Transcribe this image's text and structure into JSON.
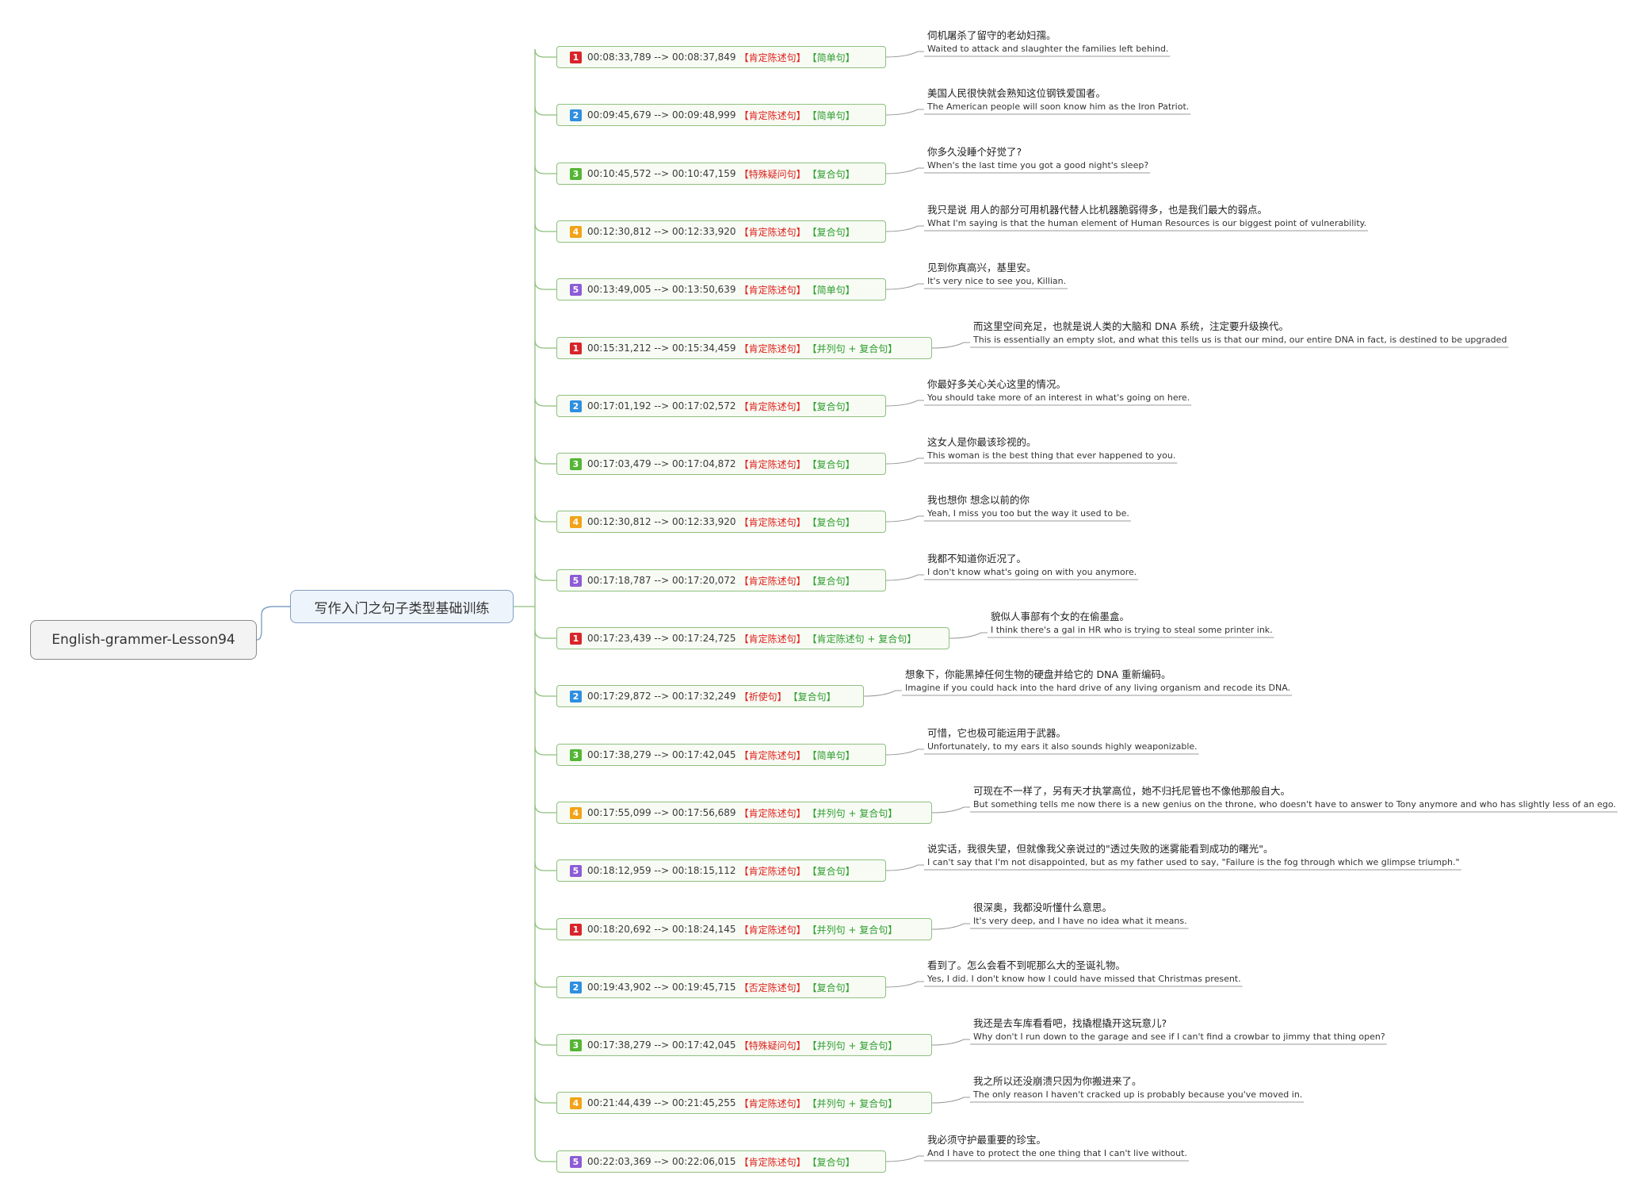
{
  "root": {
    "label": "English-grammer-Lesson94"
  },
  "main": {
    "label": "写作入门之句子类型基础训练"
  },
  "colors": {
    "1": "#d9242b",
    "2": "#2f8fe0",
    "3": "#55b535",
    "4": "#f2a318",
    "5": "#8d5cd6",
    "type_text": "#e0201b",
    "struct_text": "#2f9e2f",
    "connector": "#8cc07a"
  },
  "items": [
    {
      "num": "1",
      "time": "00:08:33,789 --> 00:08:37,849",
      "type": "【肯定陈述句】",
      "struct": "【简单句】",
      "zh": "伺机屠杀了留守的老幼妇孺。",
      "en": "Waited to attack and slaughter the families left behind."
    },
    {
      "num": "2",
      "time": "00:09:45,679 --> 00:09:48,999",
      "type": "【肯定陈述句】",
      "struct": "【简单句】",
      "zh": "美国人民很快就会熟知这位钢铁爱国者。",
      "en": "The American people will soon know him as the Iron Patriot."
    },
    {
      "num": "3",
      "time": "00:10:45,572 --> 00:10:47,159",
      "type": "【特殊疑问句】",
      "struct": "【复合句】",
      "zh": "你多久没睡个好觉了?",
      "en": "When's the last time you got a good night's sleep?"
    },
    {
      "num": "4",
      "time": "00:12:30,812 --> 00:12:33,920",
      "type": "【肯定陈述句】",
      "struct": "【复合句】",
      "zh": "我只是说 用人的部分可用机器代替人比机器脆弱得多，也是我们最大的弱点。",
      "en": "What I'm saying is that the human element of Human Resources is our biggest point of vulnerability."
    },
    {
      "num": "5",
      "time": "00:13:49,005 --> 00:13:50,639",
      "type": "【肯定陈述句】",
      "struct": "【简单句】",
      "zh": "见到你真高兴，基里安。",
      "en": "It's very nice to see you, Killian."
    },
    {
      "num": "1",
      "time": "00:15:31,212 --> 00:15:34,459",
      "type": "【肯定陈述句】",
      "struct": "【并列句 + 复合句】",
      "zh": "而这里空间充足，也就是说人类的大脑和 DNA 系统，注定要升级换代。",
      "en": "This is essentially an empty slot, and what this tells us is that our mind, our entire DNA in fact, is destined to be upgraded"
    },
    {
      "num": "2",
      "time": "00:17:01,192 --> 00:17:02,572",
      "type": "【肯定陈述句】",
      "struct": "【复合句】",
      "zh": "你最好多关心关心这里的情况。",
      "en": "You should take more of an interest in what's going on here."
    },
    {
      "num": "3",
      "time": "00:17:03,479 --> 00:17:04,872",
      "type": "【肯定陈述句】",
      "struct": "【复合句】",
      "zh": "这女人是你最该珍视的。",
      "en": "This woman is the best thing that ever happened to you."
    },
    {
      "num": "4",
      "time": "00:12:30,812 --> 00:12:33,920",
      "type": "【肯定陈述句】",
      "struct": "【复合句】",
      "zh": "我也想你 想念以前的你",
      "en": "Yeah, I miss you too but the way it used to be."
    },
    {
      "num": "5",
      "time": "00:17:18,787 --> 00:17:20,072",
      "type": "【肯定陈述句】",
      "struct": "【复合句】",
      "zh": "我都不知道你近况了。",
      "en": "I don't know what's going on with you anymore."
    },
    {
      "num": "1",
      "time": "00:17:23,439 --> 00:17:24,725",
      "type": "【肯定陈述句】",
      "struct": "【肯定陈述句 + 复合句】",
      "zh": "貌似人事部有个女的在偷墨盒。",
      "en": "I think there's a gal in HR who is trying to steal some printer ink."
    },
    {
      "num": "2",
      "time": "00:17:29,872 --> 00:17:32,249",
      "type": "【祈使句】",
      "struct": "【复合句】",
      "zh": "想象下，你能黑掉任何生物的硬盘并给它的 DNA 重新编码。",
      "en": "Imagine if you could hack into the hard drive of any living organism and recode its DNA."
    },
    {
      "num": "3",
      "time": "00:17:38,279 --> 00:17:42,045",
      "type": "【肯定陈述句】",
      "struct": "【简单句】",
      "zh": "可惜，它也极可能运用于武器。",
      "en": "Unfortunately, to my ears it also sounds highly weaponizable."
    },
    {
      "num": "4",
      "time": "00:17:55,099 --> 00:17:56,689",
      "type": "【肯定陈述句】",
      "struct": "【并列句 + 复合句】",
      "zh": "可现在不一样了，另有天才执掌高位，她不归托尼管也不像他那般自大。",
      "en": "But something tells me now there is a new genius on the throne, who doesn't have to answer to Tony anymore and who has slightly less of an ego."
    },
    {
      "num": "5",
      "time": "00:18:12,959 --> 00:18:15,112",
      "type": "【肯定陈述句】",
      "struct": "【复合句】",
      "zh": "说实话，我很失望，但就像我父亲说过的\"透过失败的迷雾能看到成功的曙光\"。",
      "en": "I can't say that I'm not disappointed, but as my father used to say, \"Failure is the fog through which we glimpse triumph.\""
    },
    {
      "num": "1",
      "time": "00:18:20,692 --> 00:18:24,145",
      "type": "【肯定陈述句】",
      "struct": "【并列句 + 复合句】",
      "zh": "很深奥，我都没听懂什么意思。",
      "en": "It's very deep, and I have no idea what it means."
    },
    {
      "num": "2",
      "time": "00:19:43,902 --> 00:19:45,715",
      "type": "【否定陈述句】",
      "struct": "【复合句】",
      "zh": "看到了。怎么会看不到呢那么大的圣诞礼物。",
      "en": "Yes, I did. I don't know how I could have missed that Christmas present."
    },
    {
      "num": "3",
      "time": "00:17:38,279 --> 00:17:42,045",
      "type": "【特殊疑问句】",
      "struct": "【并列句 + 复合句】",
      "zh": "我还是去车库看看吧，找撬棍撬开这玩意儿?",
      "en": "Why don't I run down to the garage and see if I can't find a crowbar to jimmy that thing open?"
    },
    {
      "num": "4",
      "time": "00:21:44,439 --> 00:21:45,255",
      "type": "【肯定陈述句】",
      "struct": "【并列句 + 复合句】",
      "zh": "我之所以还没崩溃只因为你搬进来了。",
      "en": "The only reason I haven't cracked up is probably because you've moved in."
    },
    {
      "num": "5",
      "time": "00:22:03,369 --> 00:22:06,015",
      "type": "【肯定陈述句】",
      "struct": "【复合句】",
      "zh": "我必须守护最重要的珍宝。",
      "en": "And I have to protect the one thing that I can't live without."
    }
  ]
}
